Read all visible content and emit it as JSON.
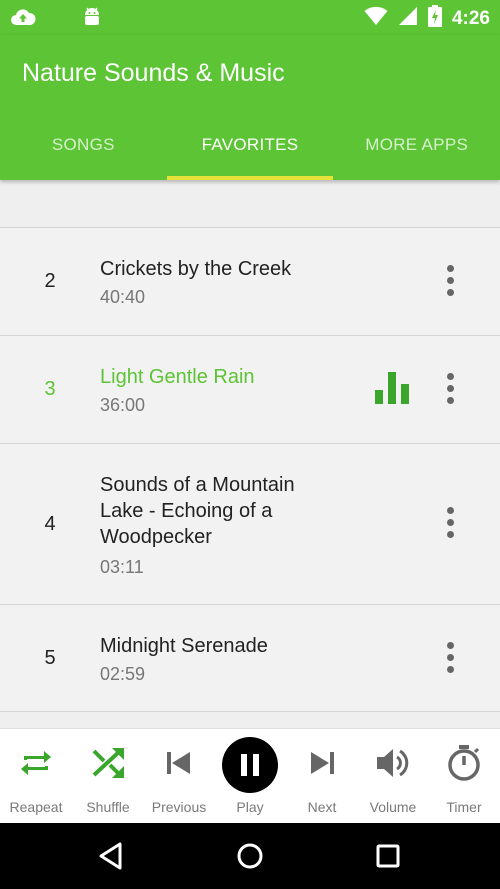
{
  "status_bar": {
    "time": "4:26",
    "icons_left": [
      "cloud-upload-icon",
      "music-note-icon",
      "android-icon"
    ],
    "icons_right": [
      "wifi-icon",
      "signal-icon",
      "battery-icon"
    ]
  },
  "app": {
    "title": "Nature Sounds & Music",
    "accent": "#5cc435",
    "tab_indicator": "#e8e13a"
  },
  "tabs": [
    {
      "label": "SONGS",
      "active": false
    },
    {
      "label": "FAVORITES",
      "active": true
    },
    {
      "label": "MORE APPS",
      "active": false
    }
  ],
  "tracks": [
    {
      "num": "2",
      "title": "Crickets by the Creek",
      "duration": "40:40",
      "playing": false
    },
    {
      "num": "3",
      "title": "Light Gentle Rain",
      "duration": "36:00",
      "playing": true
    },
    {
      "num": "4",
      "title": "Sounds of a Mountain Lake - Echoing of a Woodpecker",
      "duration": "03:11",
      "playing": false
    },
    {
      "num": "5",
      "title": "Midnight Serenade",
      "duration": "02:59",
      "playing": false
    }
  ],
  "player": {
    "repeat_label": "Reapeat",
    "shuffle_label": "Shuffle",
    "previous_label": "Previous",
    "play_label": "Play",
    "next_label": "Next",
    "volume_label": "Volume",
    "timer_label": "Timer"
  }
}
